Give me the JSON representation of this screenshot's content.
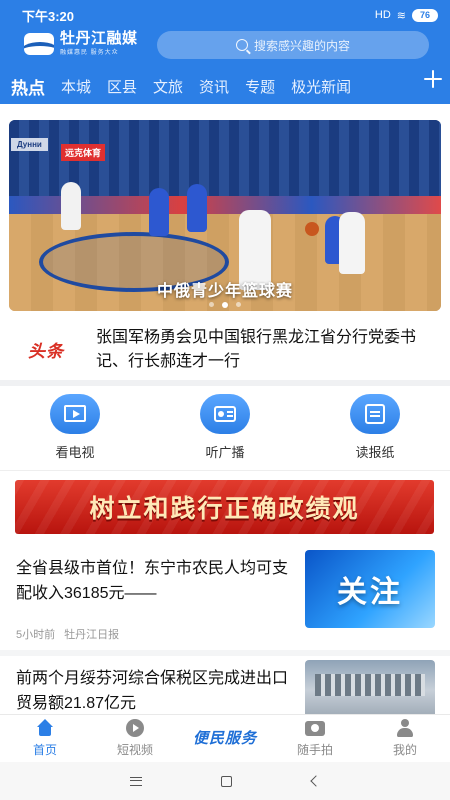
{
  "status_bar": {
    "time": "下午3:20",
    "network": "HD",
    "battery": "76"
  },
  "header": {
    "logo_title": "牡丹江融媒",
    "logo_subtitle": "融媒惠民 服务大众",
    "search_placeholder": "搜索感兴趣的内容",
    "accent_color": "#2c7fe6"
  },
  "tabs": [
    {
      "label": "热点",
      "active": true
    },
    {
      "label": "本城"
    },
    {
      "label": "区县"
    },
    {
      "label": "文旅"
    },
    {
      "label": "资讯"
    },
    {
      "label": "专题"
    },
    {
      "label": "极光新闻"
    }
  ],
  "banner": {
    "caption": "中俄青少年篮球赛",
    "slide_count": 3,
    "active_slide": 1,
    "sign_left": "Дунни",
    "sign_red": "远克体育"
  },
  "headline": {
    "tag": "头条",
    "text": "张国军杨勇会见中国银行黑龙江省分行党委书记、行长郝连才一行"
  },
  "quick_links": [
    {
      "label": "看电视",
      "icon": "tv-play-icon"
    },
    {
      "label": "听广播",
      "icon": "radio-icon"
    },
    {
      "label": "读报纸",
      "icon": "newspaper-icon"
    }
  ],
  "promo": {
    "text": "树立和践行正确政绩观"
  },
  "news": [
    {
      "title": "全省县级市首位！东宁市农民人均可支配收入36185元——",
      "time": "5小时前",
      "source": "牡丹江日报",
      "thumb_text": "关注"
    },
    {
      "title": "前两个月绥芬河综合保税区完成进出口贸易额21.87亿元"
    }
  ],
  "bottom_nav": {
    "home": "首页",
    "video": "短视频",
    "service": "便民服务",
    "snap": "随手拍",
    "mine": "我的"
  }
}
